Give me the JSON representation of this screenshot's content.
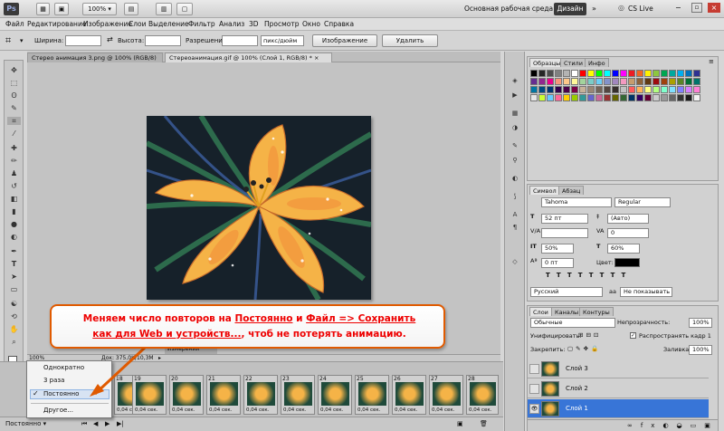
{
  "topbar": {
    "zoom": "100%",
    "workspace": "Основная рабочая среда",
    "design": "Дизайн",
    "cslive": "CS Live"
  },
  "menu": [
    "Файл",
    "Редактирование",
    "Изображение",
    "Слои",
    "Выделение",
    "Фильтр",
    "Анализ",
    "3D",
    "Просмотр",
    "Окно",
    "Справка"
  ],
  "options": {
    "width": "Ширина:",
    "height": "Высота:",
    "resolution": "Разрешение:",
    "unit": "пикс/дюйм",
    "image": "Изображение",
    "clear": "Удалить"
  },
  "tabs": [
    {
      "label": "Стерео анимация 3.png @ 100% (RGB/8)"
    },
    {
      "label": "Стереоанимация.gif @ 100% (Слой 1, RGB/8) *"
    }
  ],
  "status": {
    "zoom": "100%",
    "doc": "Док: 375,0K/10,3M",
    "measure": "Измерений"
  },
  "frames": {
    "delays": [
      "0,04 сек.",
      "0,04 сек.",
      "0,04 сек.",
      "0,04 сек.",
      "0,04 сек.",
      "0,04 сек.",
      "0,04 сек.",
      "0,04 сек.",
      "0,04 сек.",
      "0,04 сек.",
      "0,04 сек.",
      "0,04 сек."
    ],
    "numbers": [
      "18",
      "19",
      "20",
      "21",
      "22",
      "23",
      "24",
      "25",
      "26",
      "27",
      "28",
      "29"
    ]
  },
  "loop_menu": {
    "items": [
      "Однократно",
      "3 раза",
      "Постоянно",
      "Другое..."
    ],
    "checked": "✓",
    "current": "Постоянно"
  },
  "callout": {
    "pre1": "Меняем число повторов на ",
    "a1": "Постоянно",
    "mid": " и ",
    "a2": "Файл => Сохранить",
    "a3": "как для Web и устройств...",
    "post": ", чтоб не потерять анимацию."
  },
  "swatches": {
    "tabs": [
      "Образцы",
      "Стили",
      "Инфо"
    ],
    "colors": [
      "#000000",
      "#262626",
      "#4d4d4d",
      "#808080",
      "#b3b3b3",
      "#ffffff",
      "#ff0000",
      "#ffff00",
      "#00ff00",
      "#00ffff",
      "#0000ff",
      "#ff00ff",
      "#ed1c24",
      "#f26522",
      "#fff200",
      "#8dc63f",
      "#00a651",
      "#00a99d",
      "#00aeef",
      "#0072bc",
      "#2e3192",
      "#662d91",
      "#92278f",
      "#ec008c",
      "#f7977a",
      "#fdc68a",
      "#fff79a",
      "#a3d39c",
      "#7bcdc8",
      "#6dcff6",
      "#8393ca",
      "#a187be",
      "#f49ac1",
      "#c69c6d",
      "#8c6239",
      "#603913",
      "#9e0b0f",
      "#a0410d",
      "#aba000",
      "#598527",
      "#007236",
      "#00746b",
      "#0076a3",
      "#004a80",
      "#003471",
      "#32004b",
      "#4b0049",
      "#7b0046",
      "#c7b299",
      "#998675",
      "#736357",
      "#534741",
      "#362f2d",
      "#c2c2c2",
      "#ff5b5b",
      "#ffb35b",
      "#ffff80",
      "#b3ff80",
      "#80ffcc",
      "#80e0ff",
      "#8080ff",
      "#d580ff",
      "#ff80d5",
      "#e6e6e6",
      "#ccff33",
      "#66ccff",
      "#ff6699",
      "#ffcc00",
      "#99cc00",
      "#339999",
      "#6666cc",
      "#cc6699",
      "#993333",
      "#666600",
      "#336633",
      "#003366",
      "#330066",
      "#660033",
      "#cccccc",
      "#999999",
      "#666666",
      "#333333",
      "#1a1a1a",
      "#f2f2f2"
    ]
  },
  "character": {
    "tabs": [
      "Символ",
      "Абзац"
    ],
    "font": "Tahoma",
    "style": "Regular",
    "size": "52 пт",
    "leading": "(Авто)",
    "tracking": "0",
    "vscale": "50%",
    "hscale": "60%",
    "baseline": "0 пт",
    "color_label": "Цвет:",
    "lang": "Русский",
    "aa": "Не показывать"
  },
  "layers": {
    "tabs": [
      "Слои",
      "Каналы",
      "Контуры"
    ],
    "blend": "Обычные",
    "opacity_label": "Непрозрачность:",
    "opacity": "100%",
    "unify": "Унифицировать:",
    "propagate": "Распространять кадр 1",
    "lock": "Закрепить:",
    "fill_label": "Заливка:",
    "fill": "100%",
    "items": [
      "Слой 3",
      "Слой 2",
      "Слой 1"
    ]
  },
  "bottom": {
    "loop": "Постоянно"
  }
}
